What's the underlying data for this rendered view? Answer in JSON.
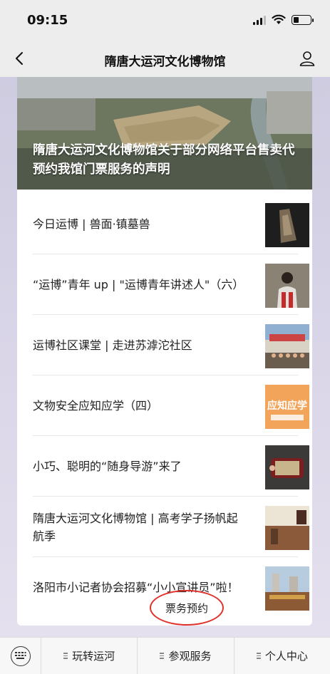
{
  "status_bar": {
    "time": "09:15"
  },
  "nav": {
    "title": "隋唐大运河文化博物馆"
  },
  "hero": {
    "title": "隋唐大运河文化博物馆关于部分网络平台售卖代预约我馆门票服务的声明"
  },
  "articles": [
    {
      "title": "今日运博 | 兽面·镇墓兽"
    },
    {
      "title": "“运博”青年 up | \"运博青年讲述人\"（六）"
    },
    {
      "title": "运博社区课堂 | 走进苏滹沱社区"
    },
    {
      "title": "文物安全应知应学（四）",
      "thumb_text": "应知应学"
    },
    {
      "title": "小巧、聪明的“随身导游”来了"
    },
    {
      "title": "隋唐大运河文化博物馆 | 高考学子扬帆起航季"
    },
    {
      "title": "洛阳市小记者协会招募“小小宣讲员”啦！"
    }
  ],
  "booking": {
    "label": "票务预约"
  },
  "bottom_menu": {
    "items": [
      "玩转运河",
      "参观服务",
      "个人中心"
    ]
  },
  "colors": {
    "highlight_circle": "#e0312b",
    "background": "#ededed"
  }
}
